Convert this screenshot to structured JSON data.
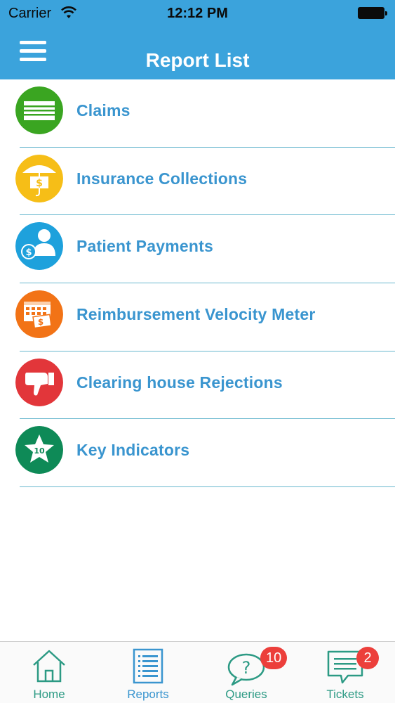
{
  "status_bar": {
    "carrier": "Carrier",
    "time": "12:12 PM"
  },
  "header": {
    "title": "Report List"
  },
  "reports": [
    {
      "label": "Claims",
      "icon": "claims-icon",
      "color": "#3aa521"
    },
    {
      "label": "Insurance Collections",
      "icon": "umbrella-money-icon",
      "color": "#f6be17"
    },
    {
      "label": "Patient Payments",
      "icon": "patient-payment-icon",
      "color": "#1ea1dc"
    },
    {
      "label": "Reimbursement Velocity Meter",
      "icon": "calendar-money-icon",
      "color": "#f27316"
    },
    {
      "label": "Clearing house Rejections",
      "icon": "thumbs-down-icon",
      "color": "#e2363a"
    },
    {
      "label": "Key Indicators",
      "icon": "star-ten-icon",
      "color": "#0e8a57",
      "icon_text": "10"
    }
  ],
  "tabbar": {
    "accent": "#2c9a84",
    "badge_color": "#ec3f3b",
    "home_label": "Home",
    "reports_label": "Reports",
    "queries_label": "Queries",
    "queries_badge": "10",
    "tickets_label": "Tickets",
    "tickets_badge": "2"
  }
}
